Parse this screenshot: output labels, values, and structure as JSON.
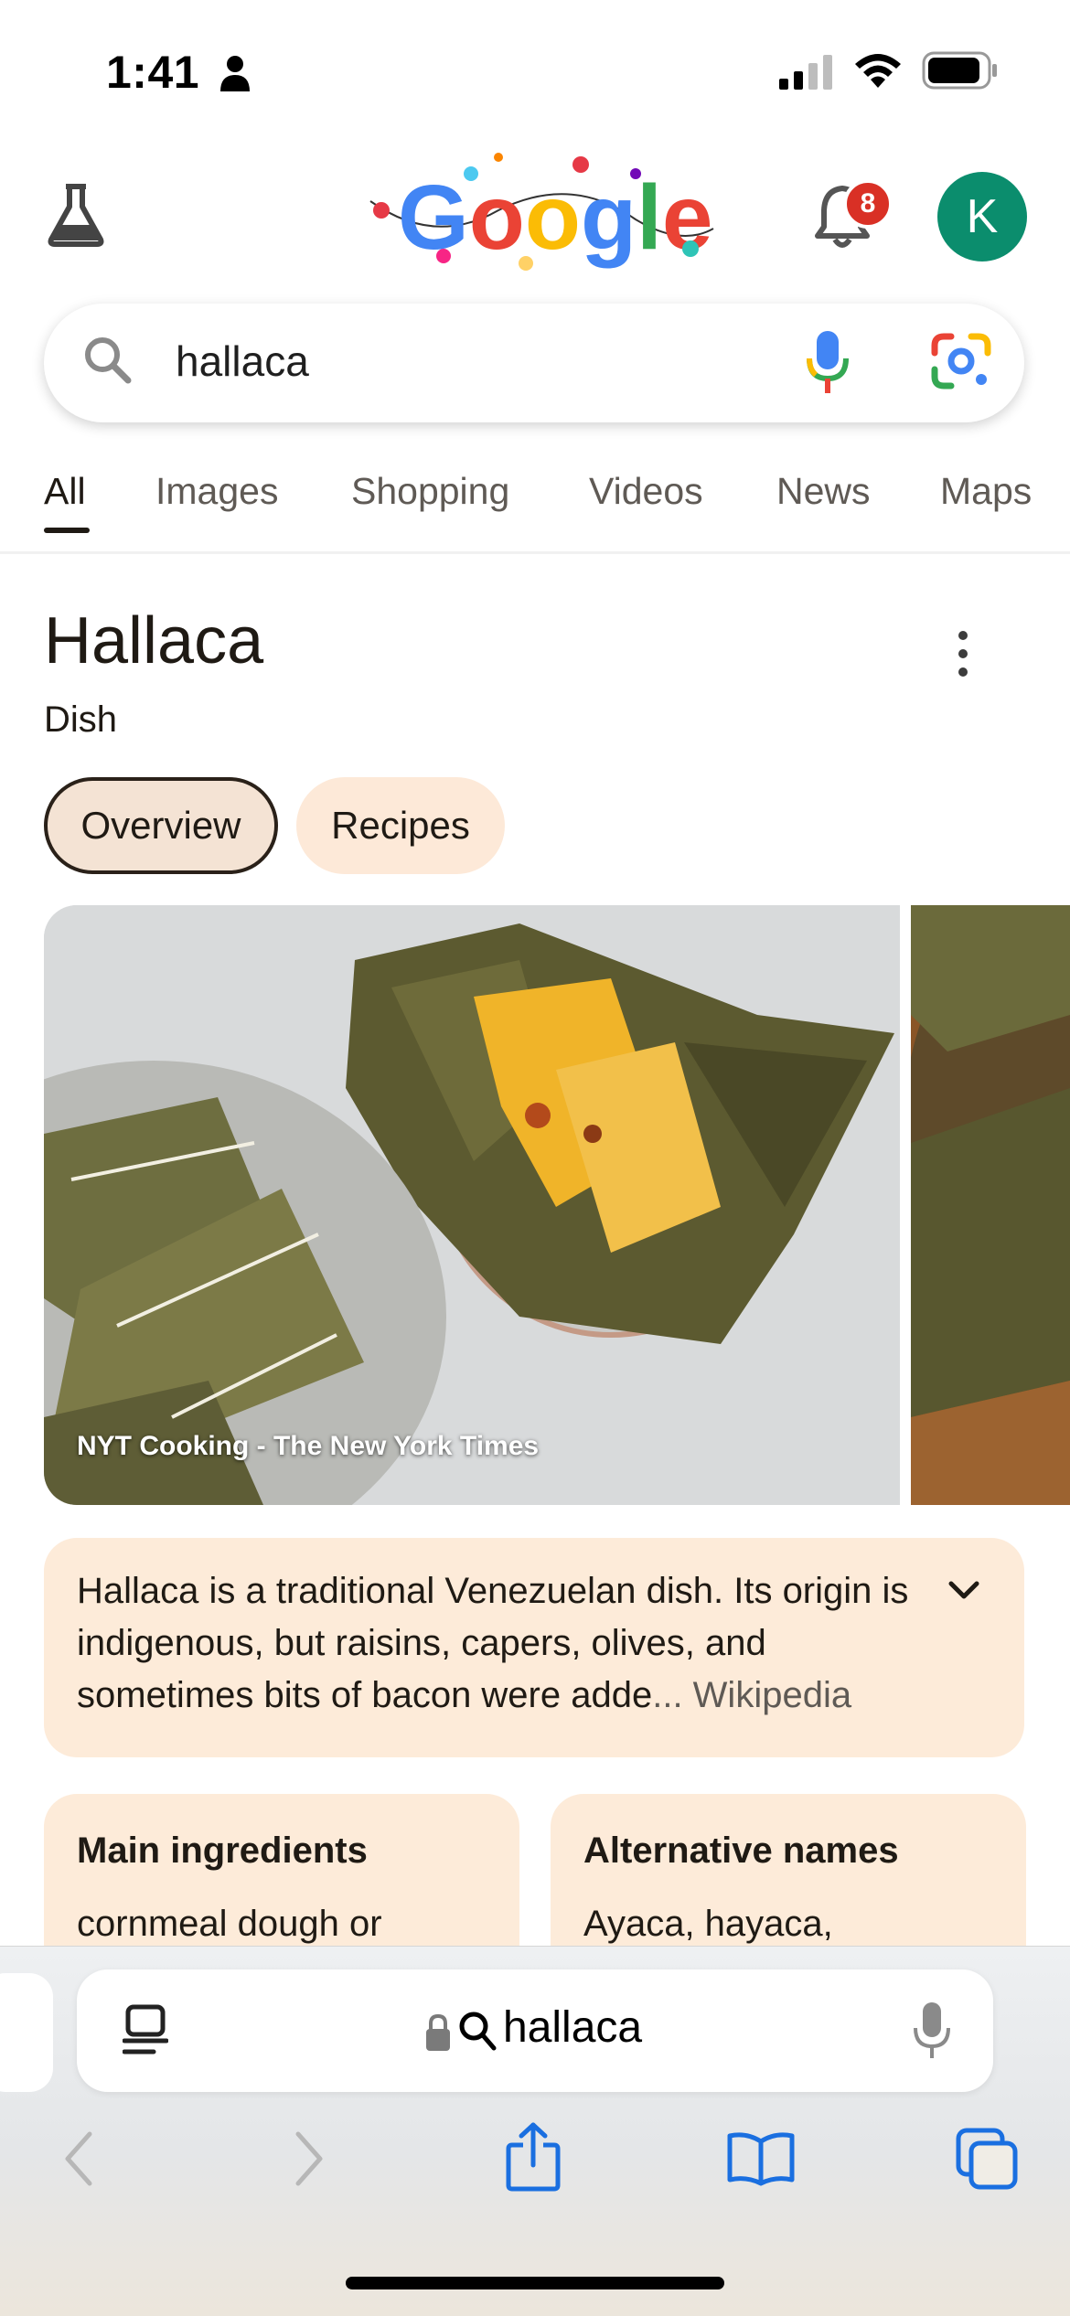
{
  "status_bar": {
    "time": "1:41"
  },
  "header": {
    "notification_count": "8",
    "avatar_initial": "K"
  },
  "search": {
    "query": "hallaca"
  },
  "tabs": [
    {
      "label": "All",
      "active": true
    },
    {
      "label": "Images"
    },
    {
      "label": "Shopping"
    },
    {
      "label": "Videos"
    },
    {
      "label": "News"
    },
    {
      "label": "Maps"
    }
  ],
  "knowledge_panel": {
    "title": "Hallaca",
    "subtitle": "Dish",
    "chips": [
      "Overview",
      "Recipes"
    ],
    "image_caption": "NYT Cooking - The New York Times",
    "description": "Hallaca is a traditional Venezuelan dish. Its origin is indigenous, but raisins, capers, olives, and sometimes bits of bacon were adde",
    "description_more": "... Wikipedia",
    "cards": [
      {
        "title": "Main ingredients",
        "value": "cornmeal dough or"
      },
      {
        "title": "Alternative names",
        "value": "Ayaca, hayaca,"
      }
    ]
  },
  "browser": {
    "url_text": "hallaca"
  },
  "colors": {
    "accent_green": "#0b8d6d",
    "card_bg": "#fdebd9",
    "badge_red": "#d93025"
  }
}
